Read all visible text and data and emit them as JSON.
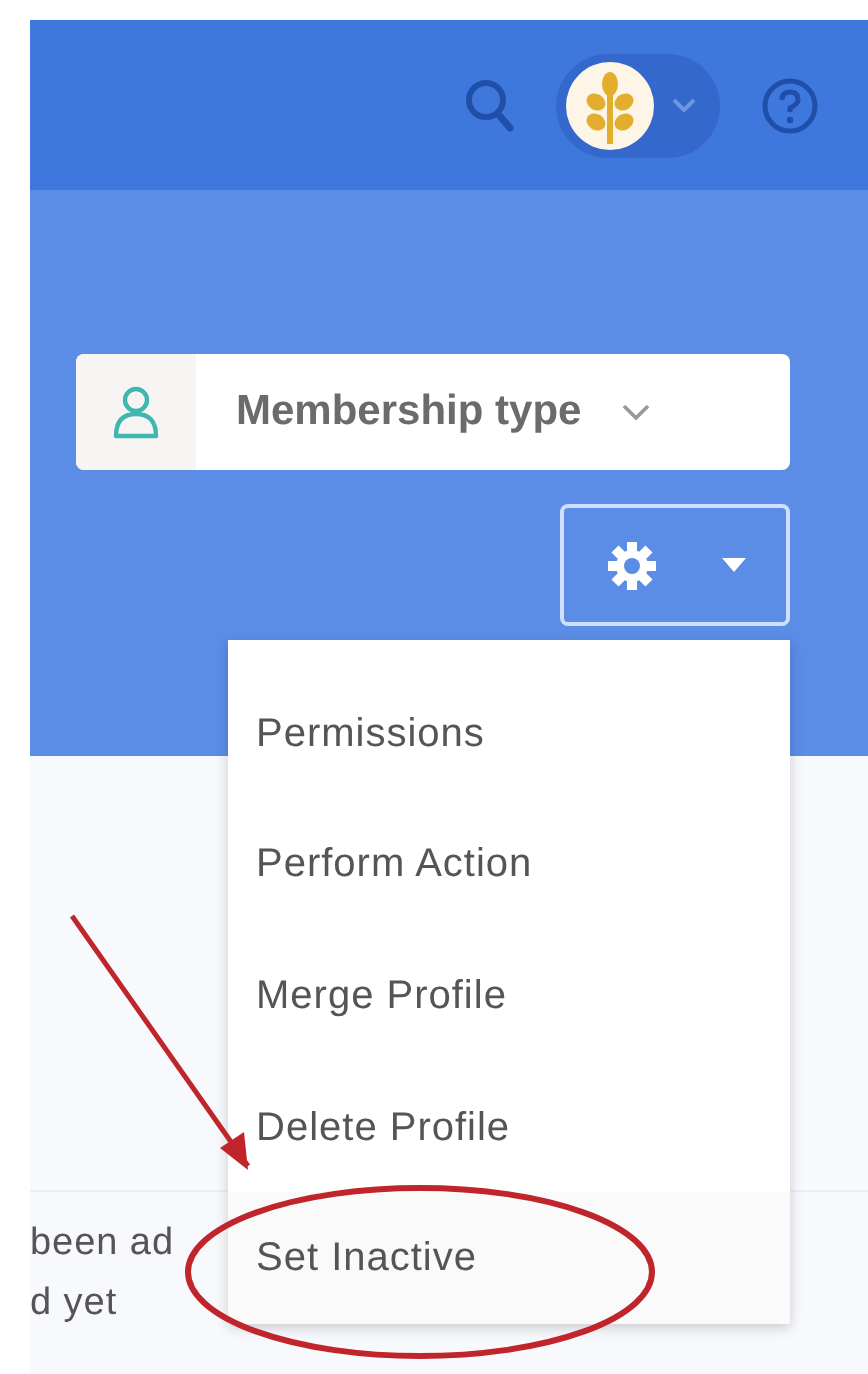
{
  "header": {
    "account_menu": {
      "expanded": false
    }
  },
  "filter": {
    "label": "Membership type"
  },
  "settings_button": {
    "open": true
  },
  "menu": {
    "items": [
      {
        "label": "Permissions",
        "highlighted": false
      },
      {
        "label": "Perform Action",
        "highlighted": false
      },
      {
        "label": "Merge Profile",
        "highlighted": false
      },
      {
        "label": "Delete Profile",
        "highlighted": false
      },
      {
        "label": "Set Inactive",
        "highlighted": true
      }
    ]
  },
  "message": {
    "lines": [
      "been ad",
      "d yet"
    ]
  }
}
